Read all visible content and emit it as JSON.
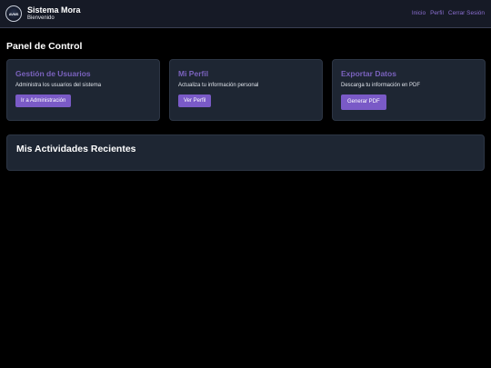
{
  "header": {
    "logo_text": "AVMS",
    "brand_title": "Sistema Mora",
    "brand_subtitle": "Bienvenido",
    "nav": [
      {
        "label": "Inicio"
      },
      {
        "label": "Perfil"
      },
      {
        "label": "Cerrar Sesión"
      }
    ]
  },
  "main": {
    "page_title": "Panel de Control",
    "cards": [
      {
        "title": "Gestión de Usuarios",
        "text": "Administra los usuarios del sistema",
        "button": "Ir a Administración"
      },
      {
        "title": "Mi Perfil",
        "text": "Actualiza tu información personal",
        "button": "Ver Perfil"
      },
      {
        "title": "Exportar Datos",
        "text": "Descarga tu información en PDF",
        "button": "Generar PDF"
      }
    ],
    "activity_title": "Mis Actividades Recientes"
  },
  "colors": {
    "background": "#000000",
    "topbar": "#161a26",
    "card": "#1e2633",
    "accent": "#7a5ac7",
    "card_title": "#7a62bd",
    "nav_link": "#8b6fd1"
  }
}
